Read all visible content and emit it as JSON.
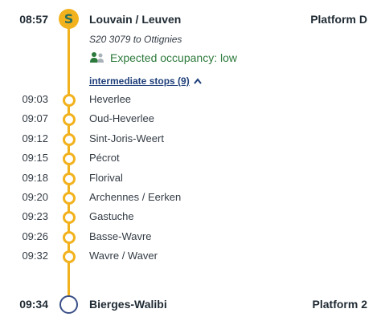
{
  "departure": {
    "time": "08:57",
    "station": "Louvain / Leuven",
    "platform": "Platform D",
    "train": "S20 3079 to Ottignies",
    "occupancy": "Expected occupancy: low",
    "badge_letter": "S"
  },
  "intermediate_toggle": {
    "label": "intermediate stops (9)",
    "icon": "chevron-up-icon"
  },
  "stops": [
    {
      "time": "09:03",
      "station": "Heverlee"
    },
    {
      "time": "09:07",
      "station": "Oud-Heverlee"
    },
    {
      "time": "09:12",
      "station": "Sint-Joris-Weert"
    },
    {
      "time": "09:15",
      "station": "Pécrot"
    },
    {
      "time": "09:18",
      "station": "Florival"
    },
    {
      "time": "09:20",
      "station": "Archennes / Eerken"
    },
    {
      "time": "09:23",
      "station": "Gastuche"
    },
    {
      "time": "09:26",
      "station": "Basse-Wavre"
    },
    {
      "time": "09:32",
      "station": "Wavre / Waver"
    }
  ],
  "arrival": {
    "time": "09:34",
    "station": "Bierges-Walibi",
    "platform": "Platform 2"
  },
  "colors": {
    "line": "#f2b21e",
    "occupancy": "#2c7a3b",
    "link": "#1f3f7a",
    "end_circle": "#3a4f87"
  }
}
